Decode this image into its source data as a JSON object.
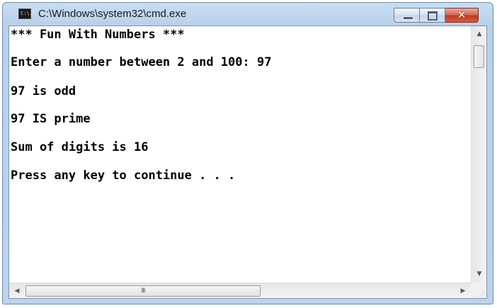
{
  "window": {
    "title": "C:\\Windows\\system32\\cmd.exe",
    "icon_text": "C:\\.",
    "icon": "cmd-console-icon"
  },
  "caption_buttons": {
    "minimize_icon": "minimize-icon",
    "maximize_icon": "maximize-icon",
    "close_glyph": "✕"
  },
  "console": {
    "lines": [
      "*** Fun With Numbers ***",
      "Enter a number between 2 and 100: 97",
      "97 is odd",
      "97 IS prime",
      "Sum of digits is 16",
      "Press any key to continue . . ."
    ],
    "background": "#ffffff",
    "foreground": "#000000"
  },
  "scrollbars": {
    "vertical_up_arrow": "▲",
    "vertical_down_arrow": "▼",
    "horizontal_left_arrow": "◀",
    "horizontal_right_arrow": "▶",
    "horizontal_thumb_grip": "III",
    "resize_grip": "⋰"
  }
}
